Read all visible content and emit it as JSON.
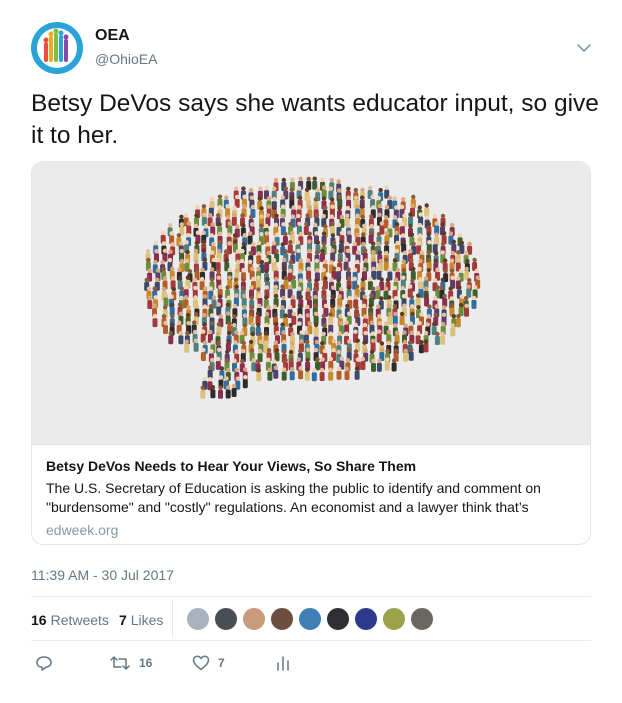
{
  "author": {
    "name": "OEA",
    "handle": "@OhioEA",
    "avatar_colors": [
      "#2aa3d8",
      "#e94e3c",
      "#f5a623",
      "#7ac143",
      "#8e44ad"
    ]
  },
  "tweet": {
    "text": "Betsy DeVos says she wants educator input, so give it to her."
  },
  "card": {
    "title": "Betsy DeVos Needs to Hear Your Views, So Share Them",
    "description": "The U.S. Secretary of Education is asking the public to identify and comment on \"burdensome\" and \"costly\" regulations. An economist and a lawyer think that’s",
    "domain": "edweek.org"
  },
  "timestamp": "11:39 AM - 30 Jul 2017",
  "stats": {
    "retweets_count": "16",
    "retweets_label": "Retweets",
    "likes_count": "7",
    "likes_label": "Likes"
  },
  "actions": {
    "reply_icon": "reply-icon",
    "retweet_icon": "retweet-icon",
    "retweet_count": "16",
    "like_icon": "heart-icon",
    "like_count": "7",
    "analytics_icon": "analytics-icon"
  },
  "colors": {
    "text": "#14171a",
    "secondary": "#657786",
    "border": "#e1e8ed"
  }
}
